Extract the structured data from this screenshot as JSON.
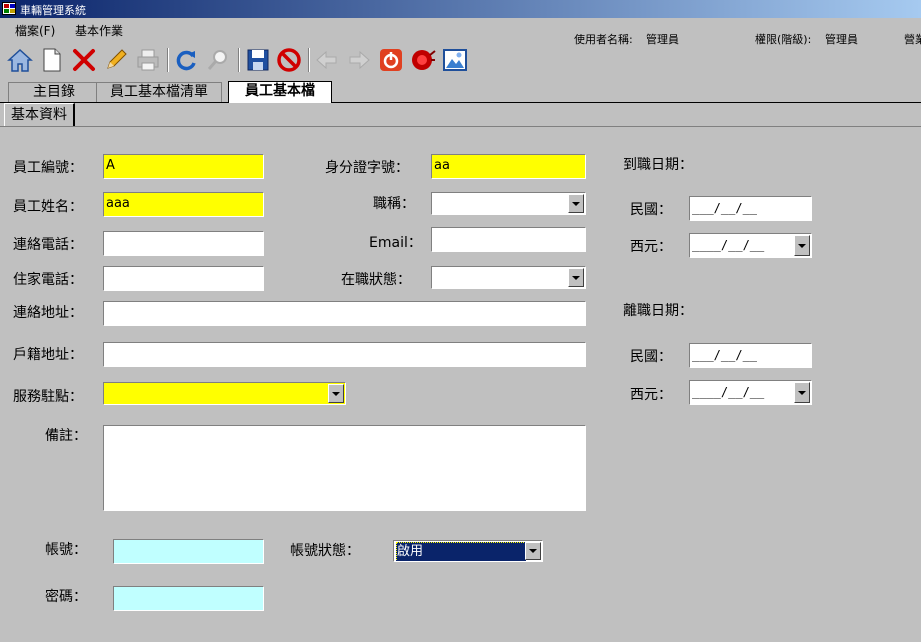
{
  "window": {
    "title": "車輛管理系統"
  },
  "menu": {
    "items": [
      "檔案(F)",
      "基本作業"
    ]
  },
  "user": {
    "name_label": "使用者名稱:",
    "name_value": "管理員",
    "level_label": "權限(階級):",
    "level_value": "管理員",
    "extra_label": "營業"
  },
  "toolbar": {
    "buttons": [
      "home-icon",
      "new-document-icon",
      "delete-icon",
      "edit-pencil-icon",
      "print-icon",
      "refresh-icon",
      "search-icon",
      "save-icon",
      "cancel-icon",
      "back-arrow-icon",
      "forward-arrow-icon",
      "power-icon",
      "alarm-icon",
      "picture-icon"
    ]
  },
  "tabs": [
    {
      "label": "主目錄"
    },
    {
      "label": "員工基本檔清單"
    },
    {
      "label": "員工基本檔"
    }
  ],
  "inner_tab": {
    "label": "基本資料"
  },
  "form": {
    "employee_no": {
      "label": "員工編號：",
      "value": "A"
    },
    "id_no": {
      "label": "身分證字號：",
      "value": "aa"
    },
    "name": {
      "label": "員工姓名：",
      "value": "aaa"
    },
    "title": {
      "label": "職稱：",
      "value": ""
    },
    "phone": {
      "label": "連絡電話：",
      "value": ""
    },
    "email": {
      "label": "Email：",
      "value": ""
    },
    "home_phone": {
      "label": "住家電話：",
      "value": ""
    },
    "status": {
      "label": "在職狀態：",
      "value": ""
    },
    "address": {
      "label": "連絡地址：",
      "value": ""
    },
    "registered_address": {
      "label": "戶籍地址：",
      "value": ""
    },
    "service_location": {
      "label": "服務駐點：",
      "value": ""
    },
    "note": {
      "label": "備註：",
      "value": ""
    },
    "account": {
      "label": "帳號：",
      "value": ""
    },
    "account_status": {
      "label": "帳號狀態：",
      "value": "啟用"
    },
    "password": {
      "label": "密碼：",
      "value": ""
    }
  },
  "dates": {
    "hire_label": "到職日期：",
    "hire_roc_label": "民國：",
    "hire_roc_value": "___/__/__",
    "hire_ad_label": "西元：",
    "hire_ad_value": "____/__/__",
    "leave_label": "離職日期：",
    "leave_roc_label": "民國：",
    "leave_roc_value": "___/__/__",
    "leave_ad_label": "西元：",
    "leave_ad_value": "____/__/__"
  },
  "colors": {
    "required": "#ffff00",
    "account": "#c0ffff",
    "titlebar": "#0a246a"
  }
}
